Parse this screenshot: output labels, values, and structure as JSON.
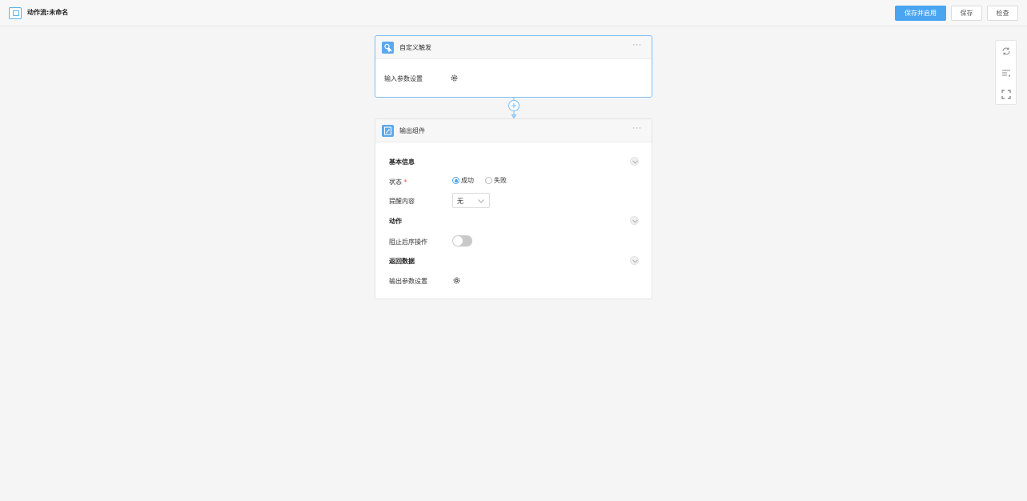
{
  "header": {
    "title": "动作流:未命名",
    "save_enable_label": "保存并启用",
    "save_label": "保存",
    "check_label": "检查"
  },
  "side_tools": [
    "refresh-icon",
    "list-sort-icon",
    "fit-screen-icon"
  ],
  "trigger_card": {
    "title": "自定义触发",
    "more": "···",
    "input_params_label": "输入参数设置"
  },
  "output_card": {
    "title": "输出组件",
    "more": "···",
    "basic_info_section": "基本信息",
    "status_label": "状态",
    "required_mark": "*",
    "status_options": [
      "成功",
      "失败"
    ],
    "status_selected": "成功",
    "message_label": "提醒内容",
    "message_value": "无",
    "action_section": "动作",
    "block_label": "阻止后序操作",
    "block_enabled": false,
    "return_section": "返回数据",
    "output_params_label": "输出参数设置"
  },
  "colors": {
    "primary": "#4aa5f0",
    "required": "#f04a4a",
    "card_active_border": "#7cbef5"
  }
}
